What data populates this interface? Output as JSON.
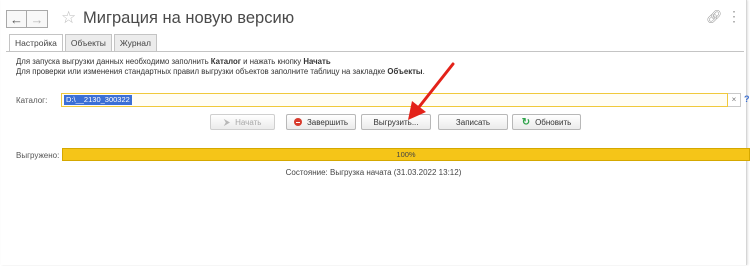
{
  "window": {
    "title": "Миграция на новую версию",
    "back_icon": "arrow-left-icon",
    "forward_icon": "arrow-right-icon",
    "favorite_icon": "star-icon",
    "link_icon": "link-icon",
    "more_icon": "more-icon"
  },
  "tabs": [
    {
      "label": "Настройка",
      "active": true
    },
    {
      "label": "Объекты",
      "active": false
    },
    {
      "label": "Журнал",
      "active": false
    }
  ],
  "info": {
    "line1_a": "Для запуска выгрузки данных необходимо заполнить ",
    "line1_b": "Каталог",
    "line1_c": " и нажать кнопку ",
    "line1_d": "Начать",
    "line2_a": "Для проверки или изменения стандартных правил выгрузки объектов заполните таблицу на закладке ",
    "line2_b": "Объекты",
    "line2_c": "."
  },
  "catalog": {
    "label": "Каталог:",
    "value": "D:\\__2130_300322",
    "clear": "×",
    "help": "?"
  },
  "buttons": {
    "start": "Начать",
    "finish": "Завершить",
    "export": "Выгрузить...",
    "save": "Записать",
    "refresh": "Обновить"
  },
  "progress": {
    "label": "Выгружено:",
    "value": 100,
    "text": "100%"
  },
  "status": "Состояние: Выгрузка начата (31.03.2022 13:12)",
  "colors": {
    "accent": "#f5c518",
    "annotation_arrow": "#e32219",
    "selection": "#3b6fd6"
  }
}
